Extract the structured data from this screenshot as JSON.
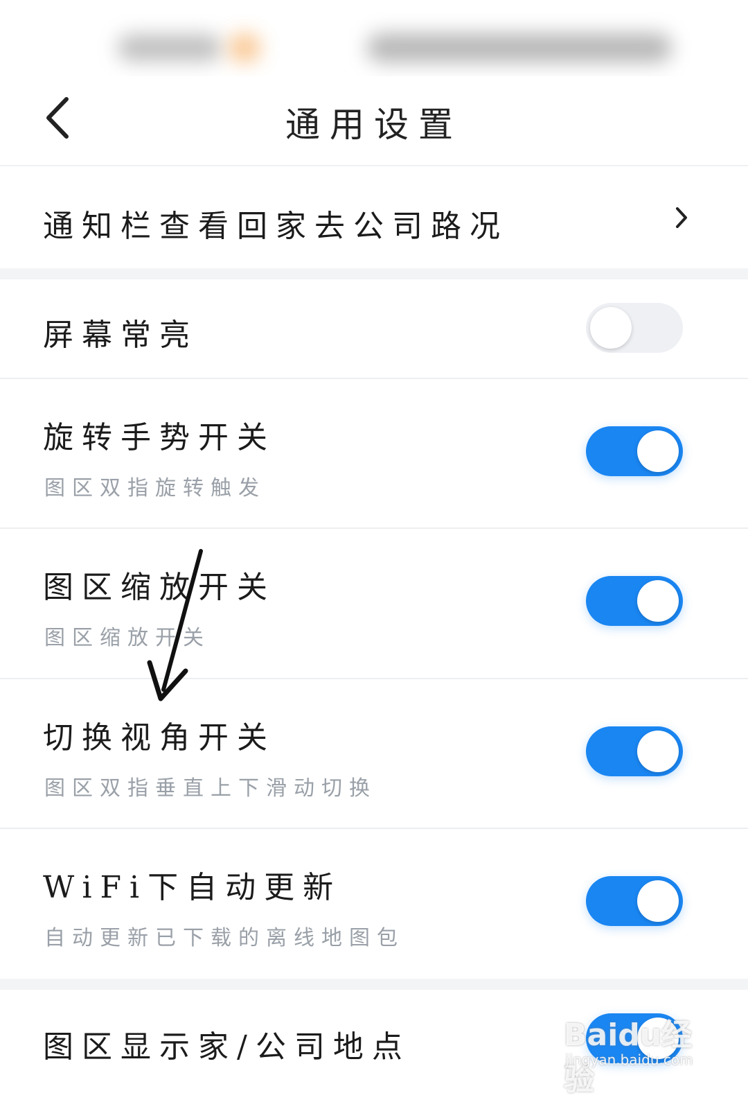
{
  "header": {
    "title": "通用设置",
    "back_icon": "chevron-left-icon"
  },
  "settings": [
    {
      "id": "notify",
      "title": "通知栏查看回家去公司路况",
      "control": "chevron-right-icon"
    },
    {
      "id": "screen",
      "title": "屏幕常亮",
      "toggle_on": false
    },
    {
      "id": "rotate",
      "title": "旋转手势开关",
      "subtitle": "图区双指旋转触发",
      "toggle_on": true
    },
    {
      "id": "zoom",
      "title": "图区缩放开关",
      "subtitle": "图区缩放开关",
      "toggle_on": true
    },
    {
      "id": "view",
      "title": "切换视角开关",
      "subtitle": "图区双指垂直上下滑动切换",
      "toggle_on": true
    },
    {
      "id": "wifi",
      "title": "WiFi下自动更新",
      "subtitle": "自动更新已下载的离线地图包",
      "toggle_on": true
    },
    {
      "id": "home",
      "title": "图区显示家/公司地点",
      "toggle_on": true
    }
  ],
  "watermark": {
    "logo": "Baidu经验",
    "url": "jingyan.baidu.com"
  },
  "colors": {
    "accent": "#1a86f2",
    "toggle_off": "#eef0f4",
    "subtitle": "#9aa0a8",
    "section_gap": "#f3f4f6"
  }
}
